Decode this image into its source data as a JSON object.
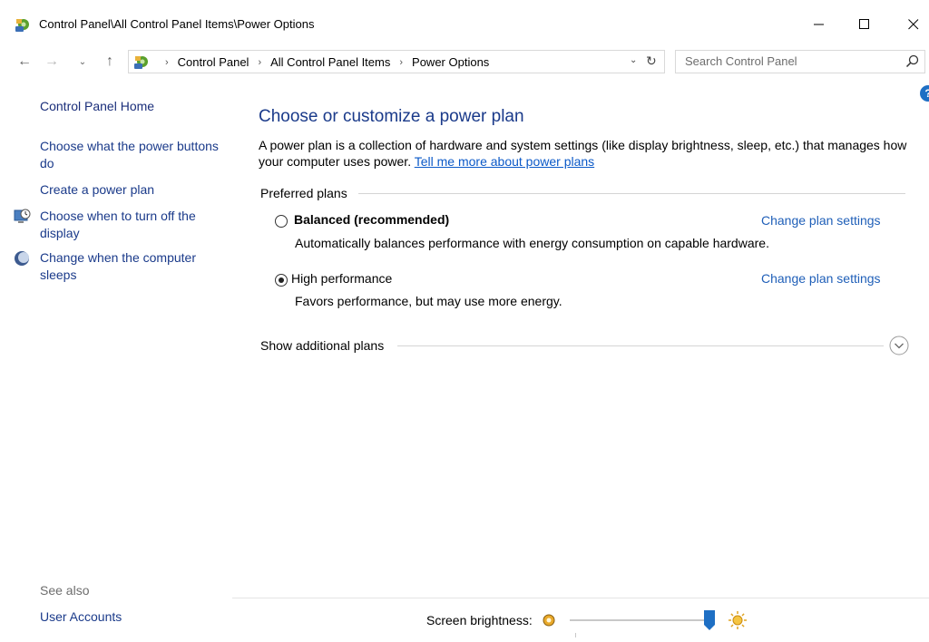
{
  "window": {
    "title": "Control Panel\\All Control Panel Items\\Power Options"
  },
  "address": {
    "crumbs": [
      "Control Panel",
      "All Control Panel Items",
      "Power Options"
    ],
    "search_placeholder": "Search Control Panel"
  },
  "sidebar": {
    "home": "Control Panel Home",
    "power_buttons": "Choose what the power buttons do",
    "create_plan": "Create a power plan",
    "display_off": "Choose when to turn off the display",
    "sleep": "Change when the computer sleeps",
    "see_also": "See also",
    "user_accounts": "User Accounts"
  },
  "main": {
    "title": "Choose or customize a power plan",
    "description": "A power plan is a collection of hardware and system settings (like display brightness, sleep, etc.) that manages how your computer uses power.",
    "tell_more_link": "Tell me more about power plans",
    "preferred_heading": "Preferred plans",
    "plans": [
      {
        "name": "Balanced (recommended)",
        "description": "Automatically balances performance with energy consumption on capable hardware.",
        "change_link": "Change plan settings",
        "selected": false
      },
      {
        "name": "High performance",
        "description": "Favors performance, but may use more energy.",
        "change_link": "Change plan settings",
        "selected": true
      }
    ],
    "show_additional": "Show additional plans"
  },
  "brightness": {
    "label": "Screen brightness:",
    "level_percent": 100
  },
  "colors": {
    "link": "#1f5fb8",
    "heading": "#1a3a8a",
    "accent": "#1e6fc4"
  }
}
